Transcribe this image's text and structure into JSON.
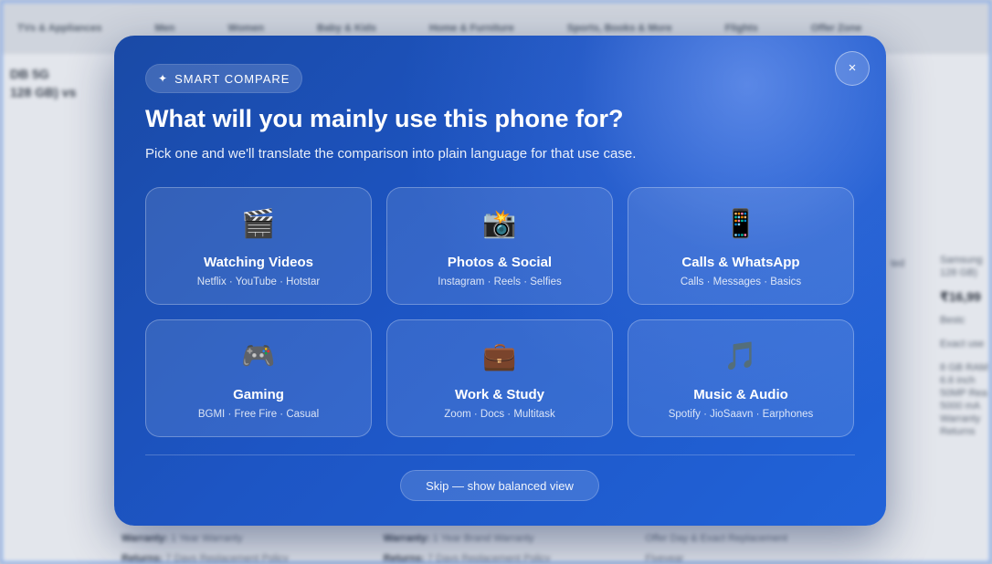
{
  "background": {
    "nav": [
      "TVs & Appliances",
      "Men",
      "Women",
      "Baby & Kids",
      "Home & Furniture",
      "Sports, Books & More",
      "Flights",
      "Offer Zone"
    ],
    "left_price_line1": "DB 5G",
    "left_price_line2": "128 GB) vs",
    "side_mid": "ted",
    "right_col": [
      "Samsung",
      "128 GB)",
      "₹16,99",
      "Bestc",
      "Exact use",
      "8 GB RAM",
      "6.6 inch",
      "50MP Rea",
      "5000 mA",
      "Warranty",
      "Returns"
    ],
    "bottom_rows": [
      [
        {
          "label": "Warranty:",
          "value": "1 Year Warranty"
        },
        {
          "label": "Warranty:",
          "value": "1 Year Brand Warranty"
        },
        {
          "label": "",
          "value": "Offer Day & Exact Replacement"
        }
      ],
      [
        {
          "label": "Returns:",
          "value": "7 Days Replacement Policy"
        },
        {
          "label": "Returns:",
          "value": "7 Days Replacement Policy"
        },
        {
          "label": "",
          "value": "Fiveyear"
        }
      ]
    ]
  },
  "modal": {
    "badge_icon": "sparkle-icon",
    "badge_label": "SMART COMPARE",
    "title": "What will you mainly use this phone for?",
    "subtitle": "Pick one and we'll translate the comparison into plain language for that use case.",
    "close_label": "×",
    "options": [
      {
        "icon": "🎬",
        "icon_name": "clapper-board-icon",
        "title": "Watching Videos",
        "subtitle": "Netflix · YouTube · Hotstar"
      },
      {
        "icon": "📸",
        "icon_name": "camera-flash-icon",
        "title": "Photos & Social",
        "subtitle": "Instagram · Reels · Selfies"
      },
      {
        "icon": "📱",
        "icon_name": "mobile-phone-icon",
        "title": "Calls & WhatsApp",
        "subtitle": "Calls · Messages · Basics"
      },
      {
        "icon": "🎮",
        "icon_name": "game-controller-icon",
        "title": "Gaming",
        "subtitle": "BGMI · Free Fire · Casual"
      },
      {
        "icon": "💼",
        "icon_name": "briefcase-icon",
        "title": "Work & Study",
        "subtitle": "Zoom · Docs · Multitask"
      },
      {
        "icon": "🎵",
        "icon_name": "music-note-icon",
        "title": "Music & Audio",
        "subtitle": "Spotify · JioSaavn · Earphones"
      }
    ],
    "skip_label": "Skip — show balanced view"
  },
  "colors": {
    "modal_start": "#1a4aa6",
    "modal_end": "#2163d9",
    "text": "#ffffff"
  }
}
